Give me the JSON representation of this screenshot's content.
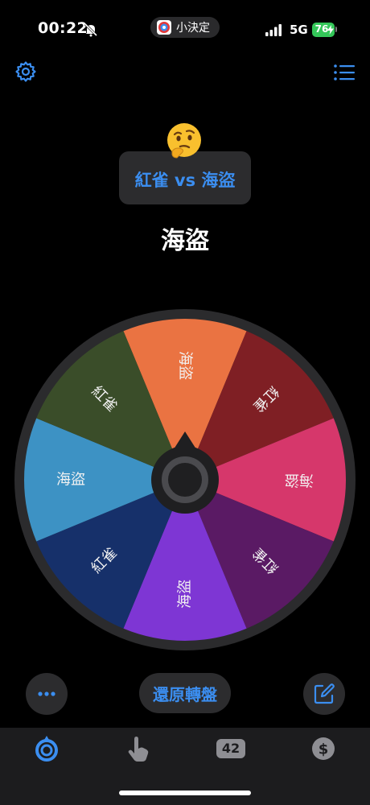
{
  "status_bar": {
    "time": "00:22",
    "island_label": "小決定",
    "network": "5G",
    "battery": "76"
  },
  "header": {
    "settings_icon": "gear-icon",
    "list_icon": "list-icon"
  },
  "title": {
    "emoji": "thinking-face",
    "text": "紅雀 vs 海盜"
  },
  "result": "海盜",
  "wheel": {
    "segments": [
      {
        "label": "海盜",
        "color": "#ea7342"
      },
      {
        "label": "紅雀",
        "color": "#7f1f24"
      },
      {
        "label": "海盜",
        "color": "#d6376b"
      },
      {
        "label": "紅雀",
        "color": "#5a1a64"
      },
      {
        "label": "海盜",
        "color": "#7e36d4"
      },
      {
        "label": "紅雀",
        "color": "#16306a"
      },
      {
        "label": "海盜",
        "color": "#3d92c4"
      },
      {
        "label": "紅雀",
        "color": "#3a4d29"
      }
    ]
  },
  "controls": {
    "reset_label": "還原轉盤"
  },
  "tab_bar": {
    "count": "42"
  },
  "colors": {
    "accent": "#3b8ef0",
    "card": "#2c2c2e",
    "tab_bar": "#1c1c1e"
  }
}
